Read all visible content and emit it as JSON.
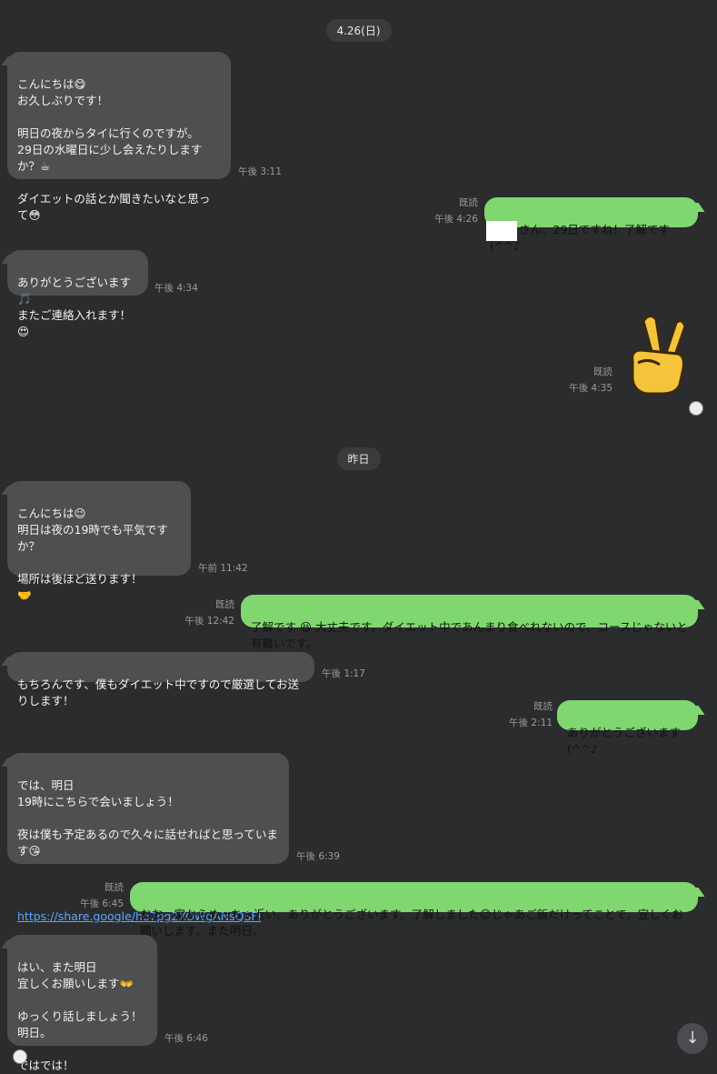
{
  "dates": {
    "first": "4.26(日)",
    "second": "昨日"
  },
  "messages": [
    {
      "dir": "in",
      "text": "こんにちは😋\nお久しぶりです！\n\n明日の夜からタイに行くのですが。\n29日の水曜日に少し会えたりしますか？☕\n\nダイエットの話とか聞きたいなと思って😳",
      "time": "午後 3:11"
    },
    {
      "dir": "out",
      "text": "さん、29日ですね！了解です(^^♪",
      "read": "既読",
      "time": "午後 4:26"
    },
    {
      "dir": "in",
      "text": "ありがとうございます🎵\nまたご連絡入れます！😍",
      "time": "午後 4:34"
    },
    {
      "dir": "out",
      "sticker": "victory-hand",
      "read": "既読",
      "time": "午後 4:35"
    },
    {
      "dir": "in",
      "text": "こんにちは😉\n明日は夜の19時でも平気ですか？\n\n場所は後ほど送ります！\n🤝",
      "time": "午前 11:42"
    },
    {
      "dir": "out",
      "text": "了解です 😆 大丈夫です。ダイエット中であんまり食べれないので、コースじゃないと有難いです。",
      "read": "既読",
      "time": "午後 12:42"
    },
    {
      "dir": "in",
      "text": "もちろんです、僕もダイエット中ですので厳選してお送りします！",
      "time": "午後 1:17"
    },
    {
      "dir": "out",
      "text": "ありがとうございます(^^♪",
      "read": "既読",
      "time": "午後 2:11"
    },
    {
      "dir": "in",
      "text": "では、明日\n19時にこちらで会いましょう！\n\n夜は僕も予定あるので久々に話せればと思っています😘",
      "link": "https://share.google/ho7pg2XOWgANsQSFI",
      "time": "午後 6:39"
    },
    {
      "dir": "out",
      "text": "おお、家からめっちゃ近い。ありがとうございます。了解しました😊じゃあご飯だけってことで。宜しくお願いします。また明日。",
      "read": "既読",
      "time": "午後 6:45"
    },
    {
      "dir": "in",
      "text": "はい、また明日\n宜しくお願いします👐\n\nゆっくり話しましょう！明日。\n\nではでは！",
      "time": "午後 6:46"
    }
  ],
  "ui": {
    "scroll_icon": "↓",
    "scroll_icon_name": "arrow-down-icon"
  },
  "colors": {
    "background": "#2b2c2e",
    "incoming_bubble": "#4e4f51",
    "outgoing_bubble": "#80d76f",
    "link": "#5aa6ff"
  }
}
